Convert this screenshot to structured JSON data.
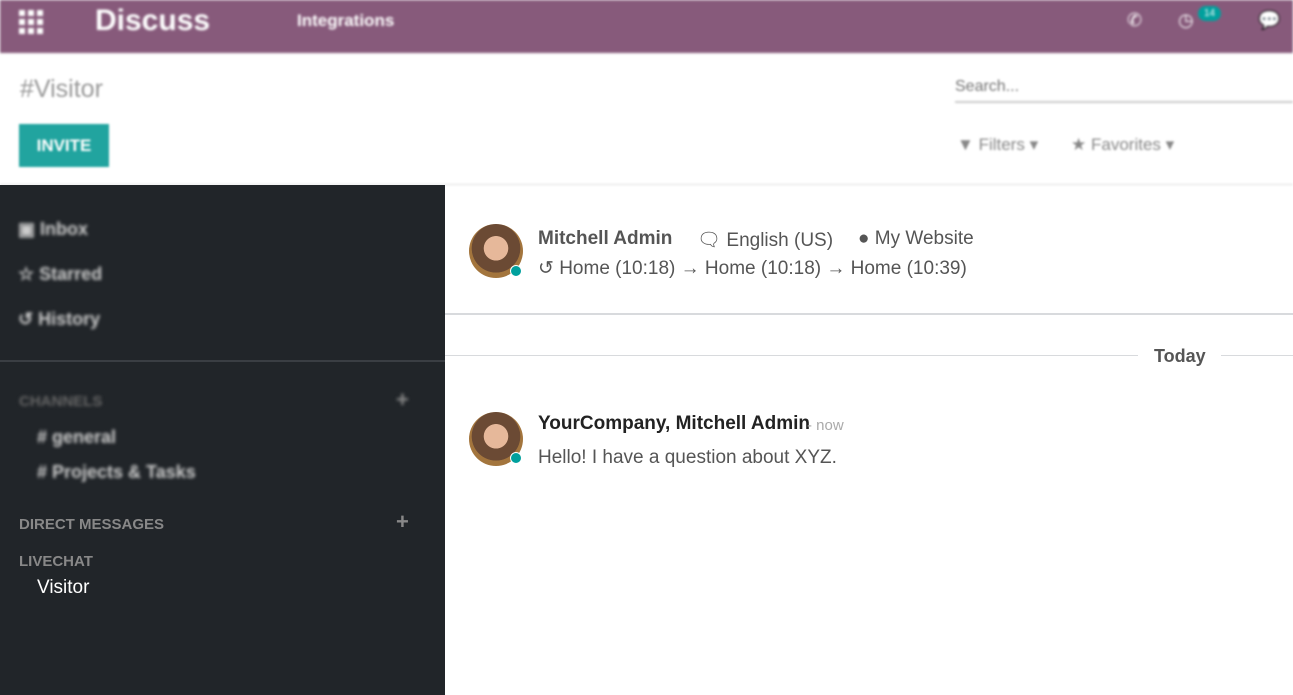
{
  "topbar": {
    "app_title": "Discuss",
    "menu": "Integrations",
    "activity_count": "14",
    "icons": [
      "apps-grid-icon",
      "phone-icon",
      "clock-icon",
      "chat-icon"
    ],
    "bg": "#875a7b"
  },
  "control_panel": {
    "title": "#Visitor",
    "invite_label": "INVITE",
    "search_placeholder": "Search...",
    "filters_label": "Filters",
    "favorites_label": "Favorites"
  },
  "sidebar": {
    "items": [
      {
        "label": "Inbox",
        "icon": "inbox-icon"
      },
      {
        "label": "Starred",
        "icon": "star-icon"
      },
      {
        "label": "History",
        "icon": "history-icon"
      }
    ],
    "channels_header": "CHANNELS",
    "channels": [
      "# general",
      "# Projects & Tasks"
    ],
    "dm_header": "DIRECT MESSAGES",
    "livechat_header": "LIVECHAT",
    "livechat_items": [
      "Visitor"
    ]
  },
  "visitor": {
    "name": "Mitchell Admin",
    "language": "English (US)",
    "website": "My Website",
    "history": "Home (10:18) → Home (10:18) → Home (10:39)"
  },
  "separator": "Today",
  "message": {
    "author": "YourCompany, Mitchell Admin",
    "time": "- now",
    "body": "Hello! I have a question about XYZ."
  },
  "colors": {
    "accent": "#00a09d",
    "sidebar": "#212529"
  }
}
